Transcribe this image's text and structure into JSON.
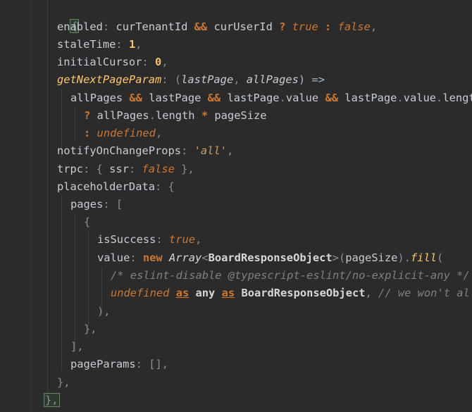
{
  "code": {
    "l1": "{",
    "l2": {
      "a": "enabled",
      "b": ": ",
      "c": "curTenantId",
      "d": " && ",
      "e": "curUserId",
      "f": " ? ",
      "g": "true",
      "h": " : ",
      "i": "false",
      "j": ","
    },
    "l3": {
      "a": "staleTime",
      "b": ": ",
      "c": "1",
      "d": ","
    },
    "l4": {
      "a": "initialCursor",
      "b": ": ",
      "c": "0",
      "d": ","
    },
    "l5": {
      "a": "getNextPageParam",
      "b": ": (",
      "c": "lastPage",
      "d": ", ",
      "e": "allPages",
      "f": ") =>"
    },
    "l6": {
      "a": "allPages",
      "b": " && ",
      "c": "lastPage",
      "d": " && ",
      "e": "lastPage",
      "f": ".",
      "g": "value",
      "h": " && ",
      "i": "lastPage",
      "j": ".",
      "k": "value",
      "l": ".",
      "m": "lengt"
    },
    "l7": {
      "a": "? ",
      "b": "allPages",
      "c": ".",
      "d": "length",
      "e": " * ",
      "f": "pageSize"
    },
    "l8": {
      "a": ": ",
      "b": "undefined",
      "c": ","
    },
    "l9": {
      "a": "notifyOnChangeProps",
      "b": ": ",
      "c": "'all'",
      "d": ","
    },
    "l10": {
      "a": "trpc",
      "b": ": { ",
      "c": "ssr",
      "d": ": ",
      "e": "false",
      "f": " },"
    },
    "l11": {
      "a": "placeholderData",
      "b": ": {"
    },
    "l12": {
      "a": "pages",
      "b": ": ["
    },
    "l13": "{",
    "l14": {
      "a": "isSuccess",
      "b": ": ",
      "c": "true",
      "d": ","
    },
    "l15": {
      "a": "value",
      "b": ": ",
      "c": "new",
      "d": " ",
      "e": "Array",
      "f": "<",
      "g": "BoardResponseObject",
      "h": ">(",
      "i": "pageSize",
      "j": ").",
      "k": "fill",
      "l": "("
    },
    "l16": "/* eslint-disable @typescript-eslint/no-explicit-any */",
    "l17": {
      "a": "undefined",
      "b": " ",
      "c": "as",
      "d": " ",
      "e": "any",
      "f": " ",
      "g": "as",
      "h": " ",
      "i": "BoardResponseObject",
      "j": ", ",
      "k": "// we won't al"
    },
    "l18": "),",
    "l19": "},",
    "l20": "],",
    "l21": {
      "a": "pageParams",
      "b": ": [],"
    },
    "l22": "},",
    "l23": "},"
  }
}
